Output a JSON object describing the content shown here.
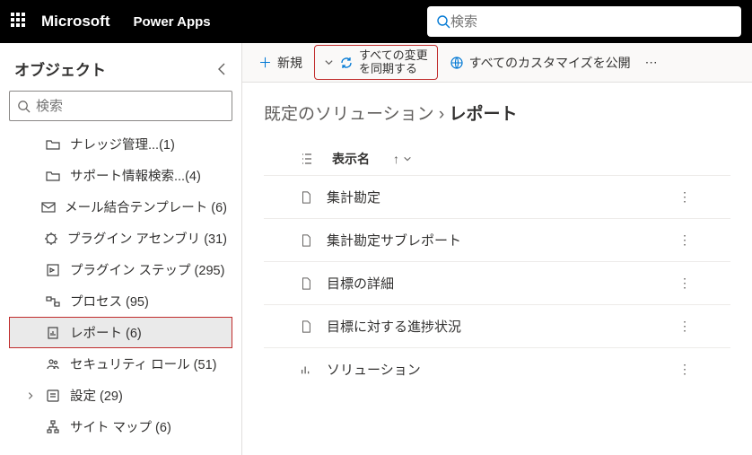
{
  "topbar": {
    "brand": "Microsoft",
    "product": "Power Apps",
    "search_placeholder": "検索"
  },
  "sidebar": {
    "title": "オブジェクト",
    "search_placeholder": "検索",
    "items": [
      {
        "label": "ナレッジ管理...(1)",
        "icon": "folder"
      },
      {
        "label": "サポート情報検索...(4)",
        "icon": "folder"
      },
      {
        "label": "メール結合テンプレート (6)",
        "icon": "mailtpl"
      },
      {
        "label": "プラグイン アセンブリ (31)",
        "icon": "plugin"
      },
      {
        "label": "プラグイン ステップ (295)",
        "icon": "step"
      },
      {
        "label": "プロセス (95)",
        "icon": "process"
      },
      {
        "label": "レポート (6)",
        "icon": "report",
        "selected": true
      },
      {
        "label": "セキュリティ ロール (51)",
        "icon": "role"
      },
      {
        "label": "設定 (29)",
        "icon": "settings",
        "expandable": true
      },
      {
        "label": "サイト マップ (6)",
        "icon": "sitemap"
      }
    ]
  },
  "commands": {
    "new": "新規",
    "sync_line1": "すべての変更",
    "sync_line2": "を同期する",
    "publish": "すべてのカスタマイズを公開"
  },
  "breadcrumb": {
    "parent": "既定のソリューション",
    "current": "レポート"
  },
  "table": {
    "column": "表示名",
    "rows": [
      {
        "name": "集計勘定",
        "icon": "doc"
      },
      {
        "name": "集計勘定サブレポート",
        "icon": "doc"
      },
      {
        "name": "目標の詳細",
        "icon": "doc"
      },
      {
        "name": "目標に対する進捗状況",
        "icon": "doc"
      },
      {
        "name": "ソリューション",
        "icon": "chart"
      }
    ]
  }
}
